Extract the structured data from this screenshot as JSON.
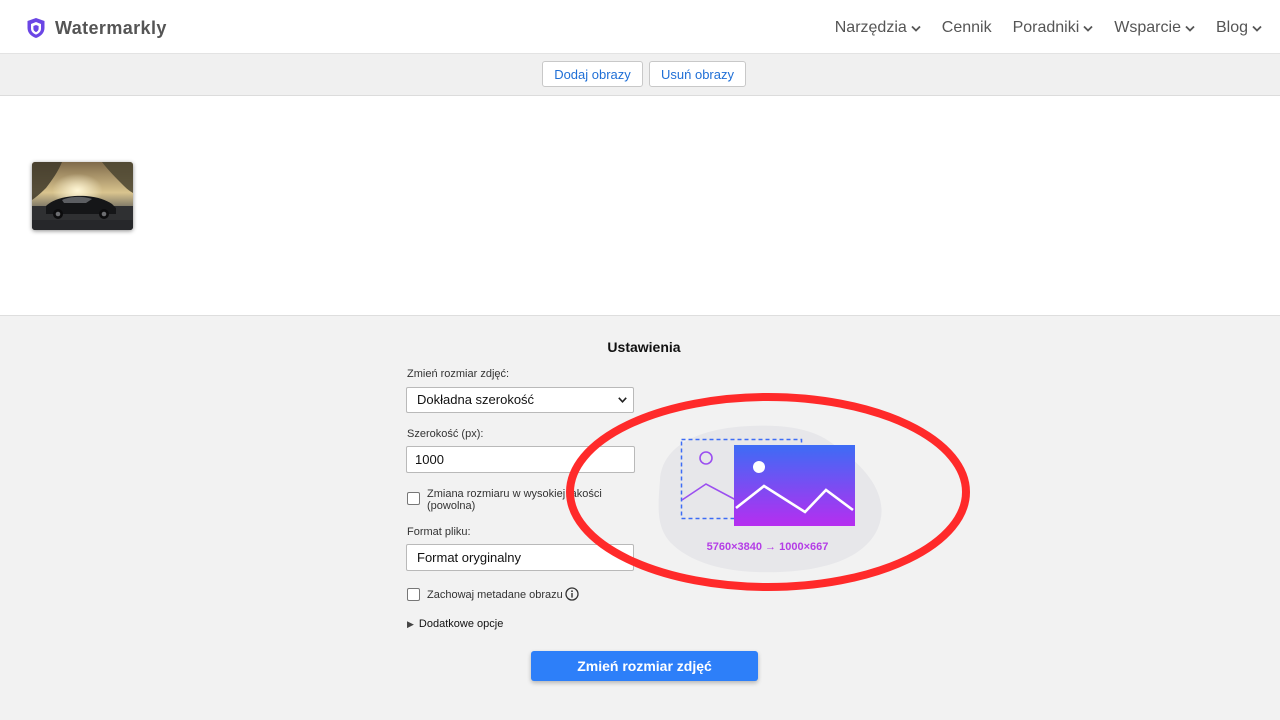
{
  "header": {
    "brand": "Watermarkly",
    "nav": [
      {
        "label": "Narzędzia",
        "dropdown": true
      },
      {
        "label": "Cennik",
        "dropdown": false
      },
      {
        "label": "Poradniki",
        "dropdown": true
      },
      {
        "label": "Wsparcie",
        "dropdown": true
      },
      {
        "label": "Blog",
        "dropdown": true
      }
    ]
  },
  "toolbar": {
    "add_images": "Dodaj obrazy",
    "remove_images": "Usuń obrazy"
  },
  "gallery": {
    "items": [
      {
        "alt": "car-photo"
      }
    ]
  },
  "settings": {
    "title": "Ustawienia",
    "resize_label": "Zmień rozmiar zdjęć:",
    "resize_mode": "Dokładna szerokość",
    "width_label": "Szerokość (px):",
    "width_value": "1000",
    "hq_resize": {
      "label": "Zmiana rozmiaru w wysokiej jakości (powolna)",
      "checked": false
    },
    "format_label": "Format pliku:",
    "format_value": "Format oryginalny",
    "keep_metadata": {
      "label": "Zachowaj metadane obrazu",
      "checked": false
    },
    "more_options": "Dodatkowe opcje",
    "submit": "Zmień rozmiar zdjęć"
  },
  "illustration": {
    "dimensions": "5760×3840 → 1000×667"
  },
  "colors": {
    "accent": "#2d7ff9",
    "link": "#1f6fd6",
    "brand_shield": "#6b46e5",
    "highlight_circle": "#ff2a2a",
    "illustration_text": "#b43ee6"
  },
  "icons": {
    "logo": "shield-icon",
    "dropdown": "chevron-down-icon",
    "info": "info-icon",
    "expand": "triangle-right-icon"
  }
}
